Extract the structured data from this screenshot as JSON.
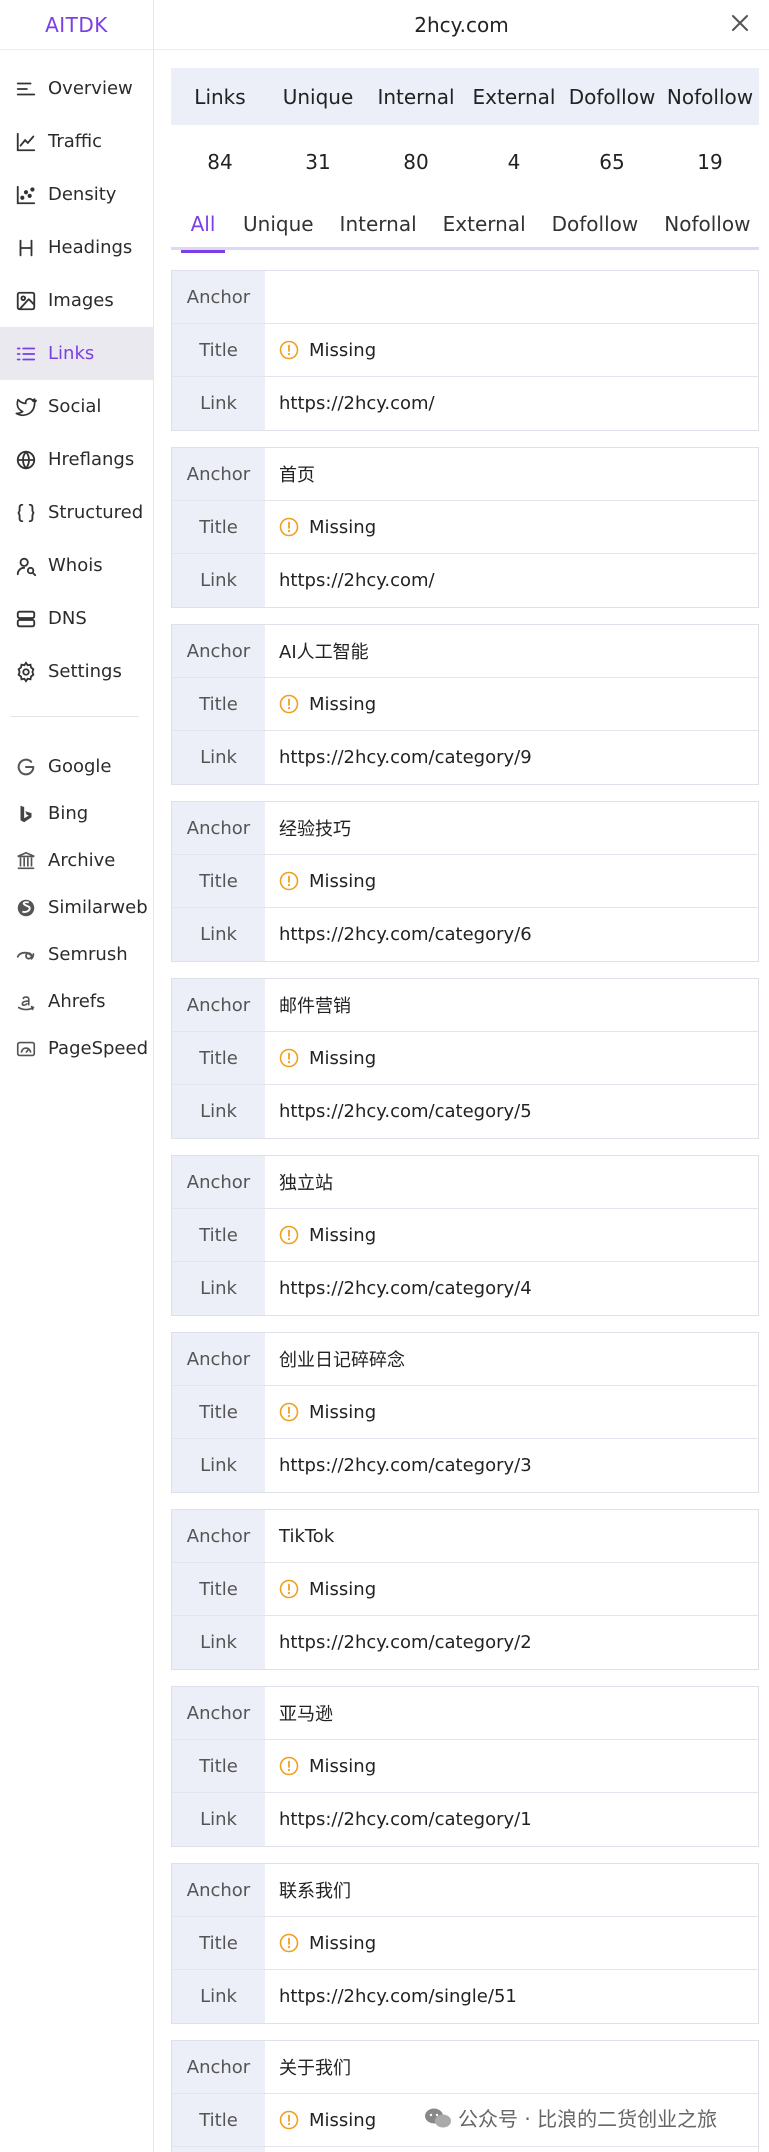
{
  "app": {
    "brand": "AITDK",
    "site_title": "2hcy.com"
  },
  "sidebar": {
    "items": [
      {
        "label": "Overview",
        "icon": "overview-icon"
      },
      {
        "label": "Traffic",
        "icon": "chart-line-icon"
      },
      {
        "label": "Density",
        "icon": "scatter-icon"
      },
      {
        "label": "Headings",
        "icon": "heading-icon"
      },
      {
        "label": "Images",
        "icon": "image-icon"
      },
      {
        "label": "Links",
        "icon": "list-icon"
      },
      {
        "label": "Social",
        "icon": "twitter-icon"
      },
      {
        "label": "Hreflangs",
        "icon": "globe-icon"
      },
      {
        "label": "Structured",
        "icon": "braces-icon"
      },
      {
        "label": "Whois",
        "icon": "user-search-icon"
      },
      {
        "label": "DNS",
        "icon": "server-icon"
      },
      {
        "label": "Settings",
        "icon": "gear-icon"
      }
    ],
    "active": "Links",
    "external": [
      {
        "label": "Google",
        "icon": "google-icon"
      },
      {
        "label": "Bing",
        "icon": "bing-icon"
      },
      {
        "label": "Archive",
        "icon": "archive-icon"
      },
      {
        "label": "Similarweb",
        "icon": "similarweb-icon"
      },
      {
        "label": "Semrush",
        "icon": "semrush-icon"
      },
      {
        "label": "Ahrefs",
        "icon": "amazon-icon"
      },
      {
        "label": "PageSpeed",
        "icon": "speedometer-icon"
      }
    ]
  },
  "stats": {
    "headers": [
      "Links",
      "Unique",
      "Internal",
      "External",
      "Dofollow",
      "Nofollow"
    ],
    "values": [
      "84",
      "31",
      "80",
      "4",
      "65",
      "19"
    ]
  },
  "tabs": [
    "All",
    "Unique",
    "Internal",
    "External",
    "Dofollow",
    "Nofollow"
  ],
  "active_tab": "All",
  "row_labels": {
    "anchor": "Anchor",
    "title": "Title",
    "link": "Link"
  },
  "links": [
    {
      "anchor": "",
      "title": "Missing",
      "link": "https://2hcy.com/"
    },
    {
      "anchor": "首页",
      "title": "Missing",
      "link": "https://2hcy.com/"
    },
    {
      "anchor": "AI人工智能",
      "title": "Missing",
      "link": "https://2hcy.com/category/9"
    },
    {
      "anchor": "经验技巧",
      "title": "Missing",
      "link": "https://2hcy.com/category/6"
    },
    {
      "anchor": "邮件营销",
      "title": "Missing",
      "link": "https://2hcy.com/category/5"
    },
    {
      "anchor": "独立站",
      "title": "Missing",
      "link": "https://2hcy.com/category/4"
    },
    {
      "anchor": "创业日记碎碎念",
      "title": "Missing",
      "link": "https://2hcy.com/category/3"
    },
    {
      "anchor": "TikTok",
      "title": "Missing",
      "link": "https://2hcy.com/category/2"
    },
    {
      "anchor": "亚马逊",
      "title": "Missing",
      "link": "https://2hcy.com/category/1"
    },
    {
      "anchor": "联系我们",
      "title": "Missing",
      "link": "https://2hcy.com/single/51"
    },
    {
      "anchor": "关于我们",
      "title": "Missing",
      "link": ""
    }
  ],
  "watermark": "公众号 · 比浪的二货创业之旅",
  "colors": {
    "accent": "#7b3fe4",
    "warning": "#f0a020",
    "header_bg": "#eceef8"
  }
}
